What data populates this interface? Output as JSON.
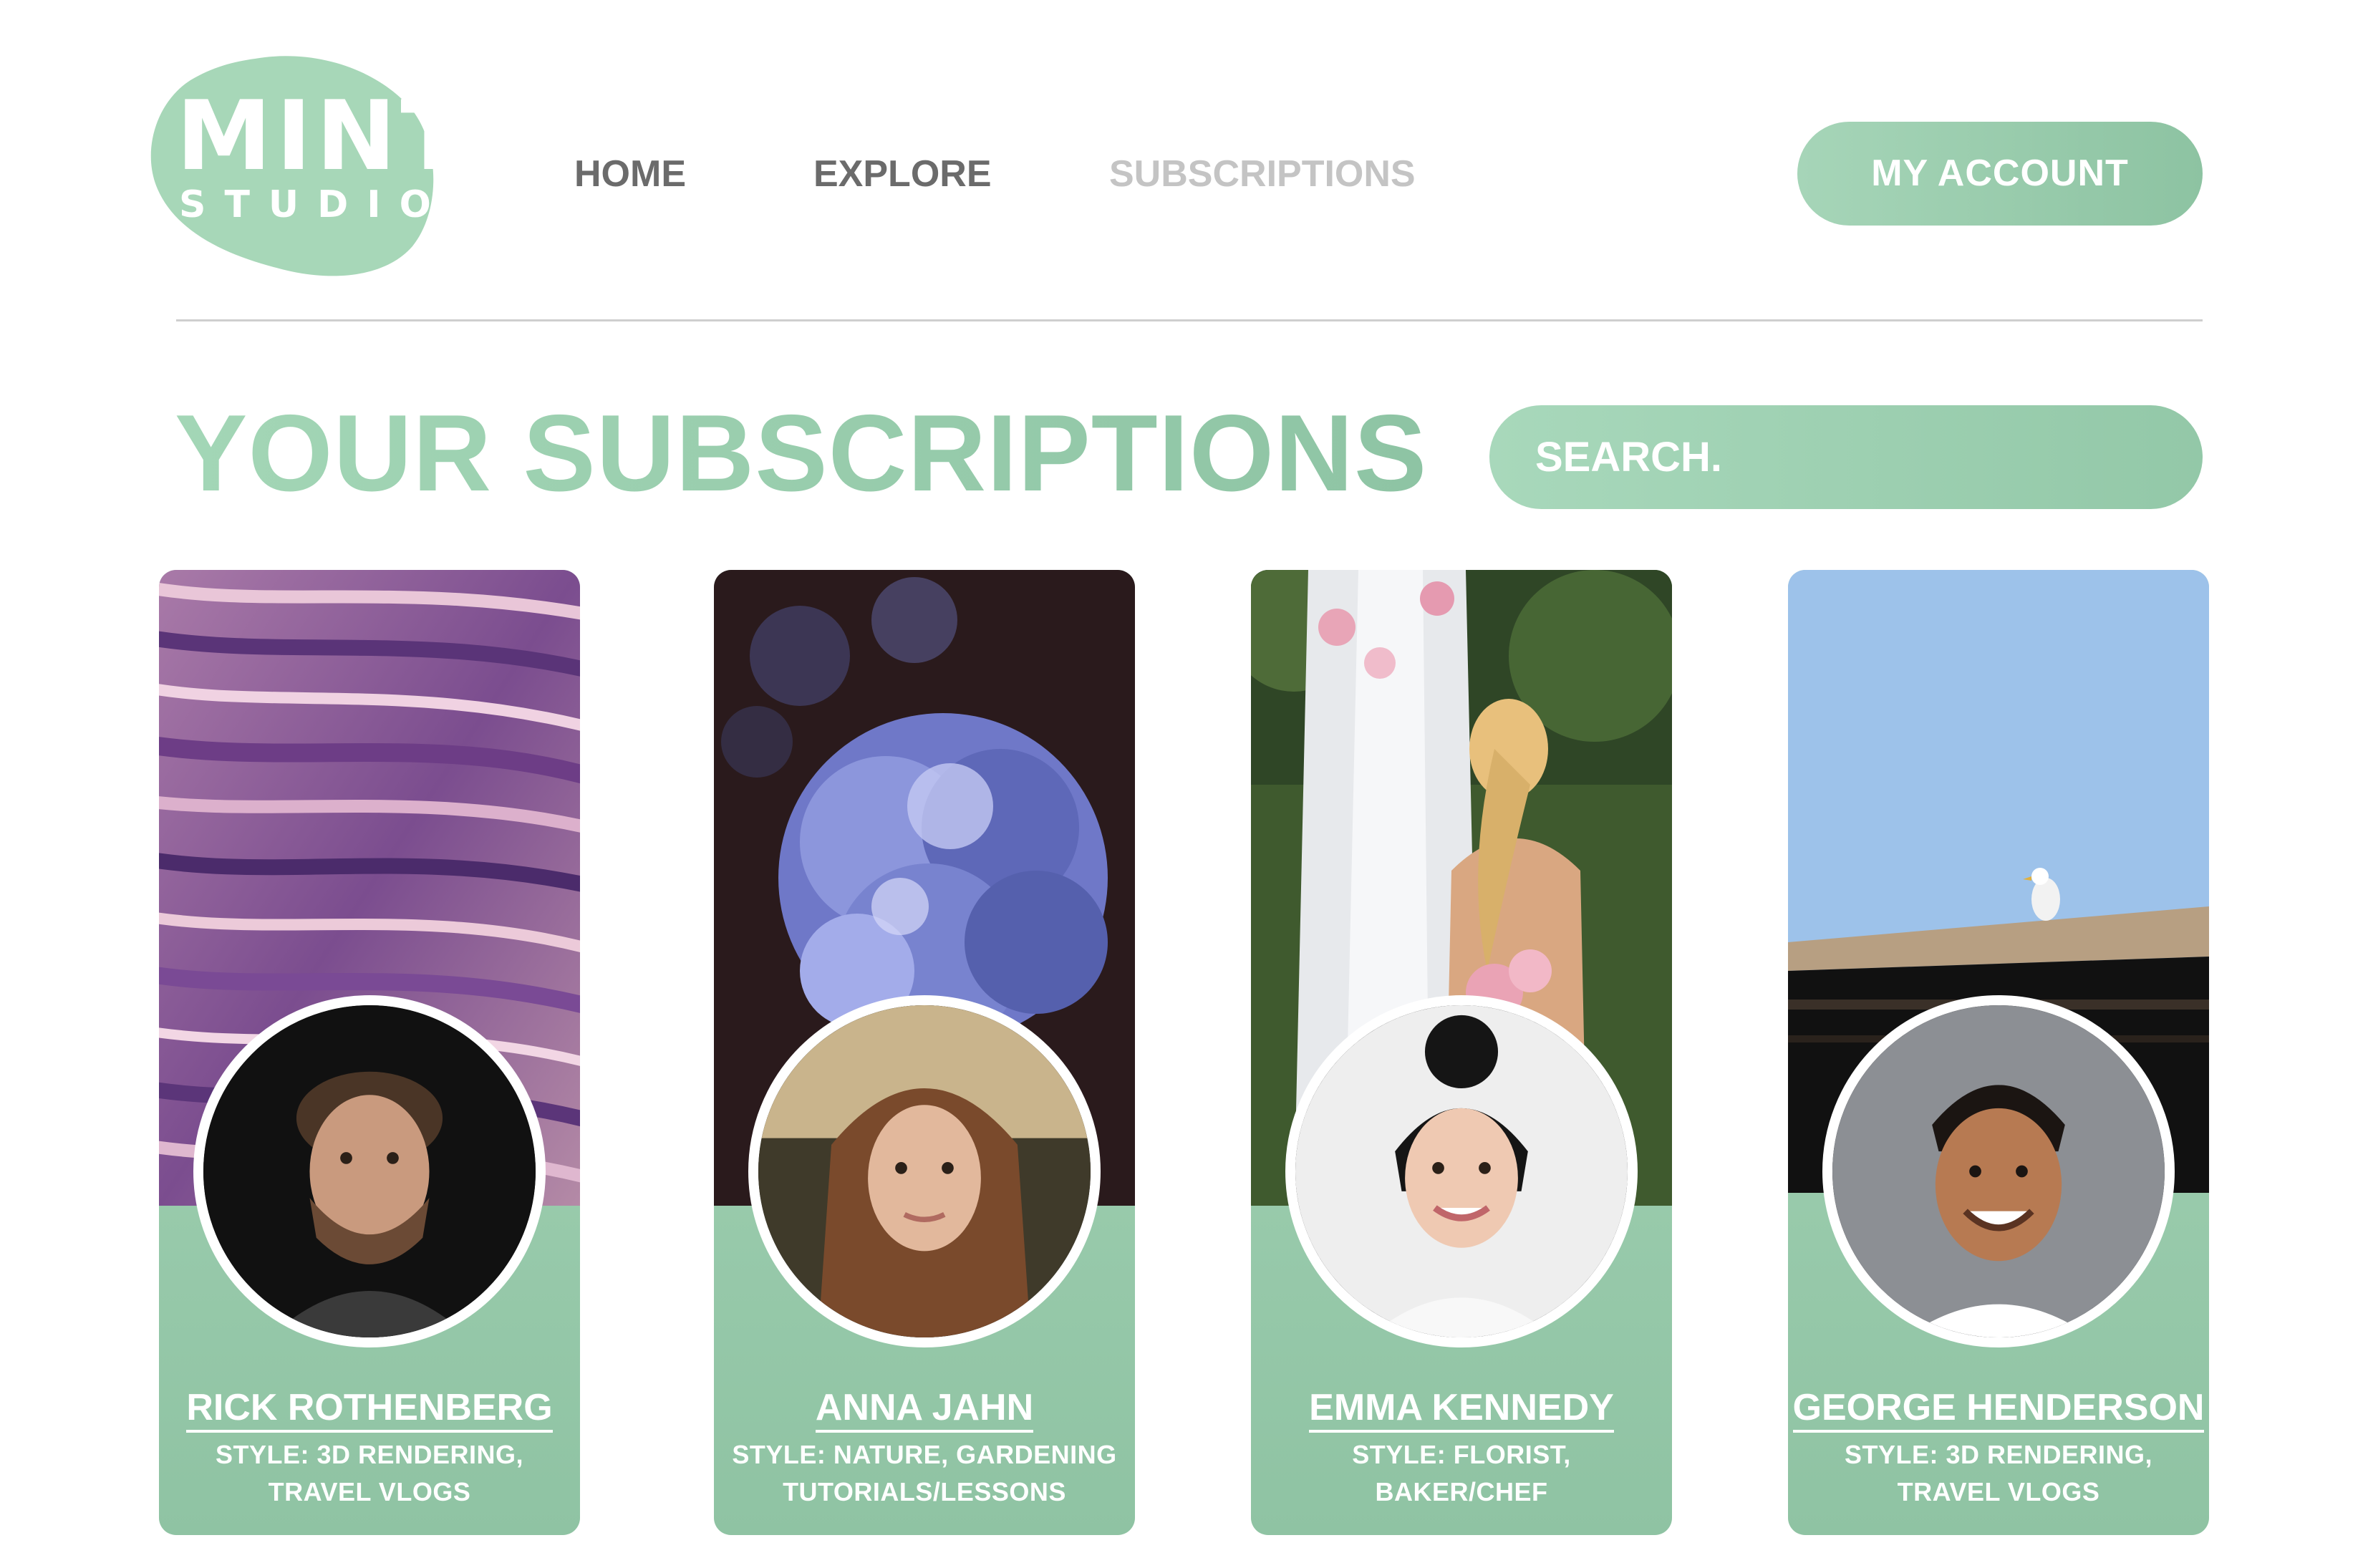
{
  "brand": {
    "logo_word": "MINT",
    "logo_sub": "STUDIO",
    "color": "#a7d7b8"
  },
  "nav": {
    "items": [
      {
        "label": "HOME",
        "active": false
      },
      {
        "label": "EXPLORE",
        "active": false
      },
      {
        "label": "SUBSCRIPTIONS",
        "active": true
      }
    ]
  },
  "account": {
    "label": "MY ACCOUNT"
  },
  "page": {
    "title": "YOUR SUBSCRIPTIONS"
  },
  "search": {
    "placeholder": "SEARCH."
  },
  "subscriptions": [
    {
      "name": "RICK ROTHENBERG",
      "style_line1": "STYLE: 3D RENDERING,",
      "style_line2": "TRAVEL VLOGS"
    },
    {
      "name": "ANNA JAHN",
      "style_line1": "STYLE: NATURE, GARDENING",
      "style_line2": "TUTORIALS/LESSONS"
    },
    {
      "name": "EMMA KENNEDY",
      "style_line1": "STYLE: FLORIST,",
      "style_line2": "BAKER/CHEF"
    },
    {
      "name": "GEORGE HENDERSON",
      "style_line1": "STYLE: 3D RENDERING,",
      "style_line2": "TRAVEL VLOGS"
    }
  ],
  "colors": {
    "accent": "#a7d7b8",
    "accent_dark": "#8ec4a4",
    "nav_text": "#6b6b6b",
    "nav_active": "#c4c4c4"
  }
}
